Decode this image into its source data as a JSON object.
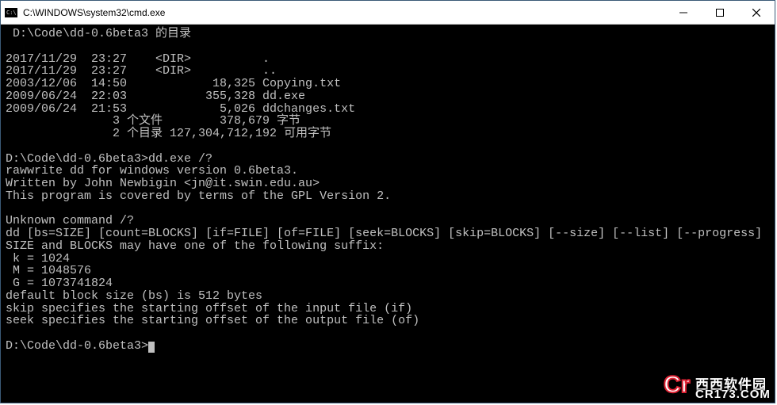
{
  "titlebar": {
    "title": "C:\\WINDOWS\\system32\\cmd.exe"
  },
  "terminal": {
    "dir_header": " D:\\Code\\dd-0.6beta3 的目录",
    "entries": [
      "2017/11/29  23:27    <DIR>          .",
      "2017/11/29  23:27    <DIR>          ..",
      "2003/12/06  14:50            18,325 Copying.txt",
      "2009/06/24  22:03           355,328 dd.exe",
      "2009/06/24  21:53             5,026 ddchanges.txt"
    ],
    "summary1": "               3 个文件        378,679 字节",
    "summary2": "               2 个目录 127,304,712,192 可用字节",
    "cmd1_prompt": "D:\\Code\\dd-0.6beta3>",
    "cmd1_input": "dd.exe /?",
    "out1": "rawwrite dd for windows version 0.6beta3.",
    "out2": "Written by John Newbigin <jn@it.swin.edu.au>",
    "out3": "This program is covered by terms of the GPL Version 2.",
    "out5": "Unknown command /?",
    "out6": "dd [bs=SIZE] [count=BLOCKS] [if=FILE] [of=FILE] [seek=BLOCKS] [skip=BLOCKS] [--size] [--list] [--progress]",
    "out7": "SIZE and BLOCKS may have one of the following suffix:",
    "out8": " k = 1024",
    "out9": " M = 1048576",
    "out10": " G = 1073741824",
    "out11": "default block size (bs) is 512 bytes",
    "out12": "skip specifies the starting offset of the input file (if)",
    "out13": "seek specifies the starting offset of the output file (of)",
    "cmd2_prompt": "D:\\Code\\dd-0.6beta3>"
  },
  "watermark": {
    "cr": "Cr",
    "cn": "西西软件园",
    "url": "CR173.COM"
  }
}
